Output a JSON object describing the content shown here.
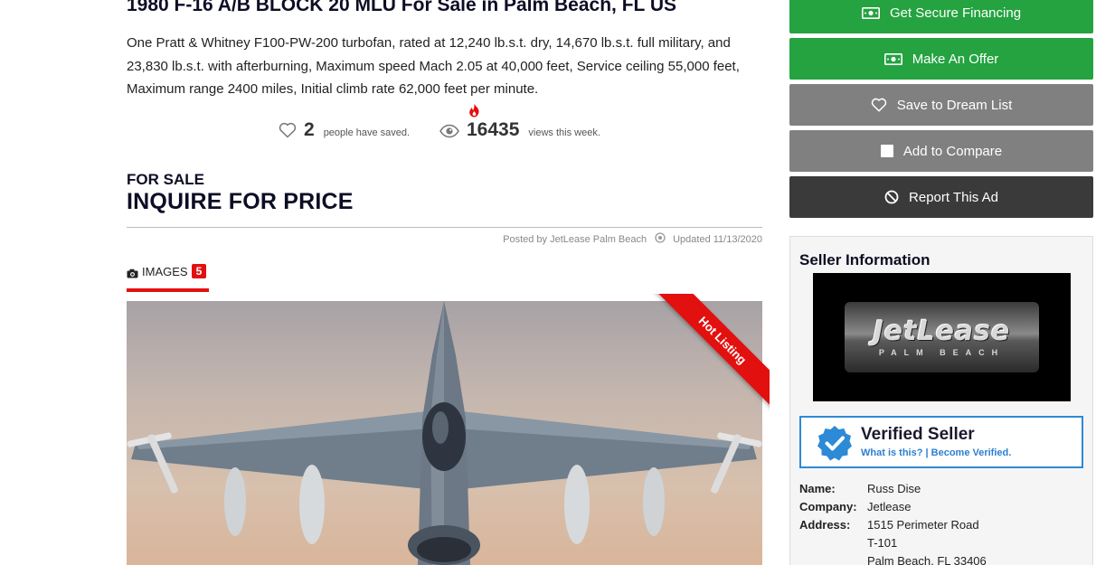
{
  "listing": {
    "title": "1980 F-16 A/B BLOCK 20 MLU For Sale in Palm Beach, FL US",
    "description": "One Pratt & Whitney F100-PW-200 turbofan, rated at 12,240 lb.s.t. dry, 14,670 lb.s.t. full military, and 23,830 lb.s.t. with afterburning, Maximum speed Mach 2.05 at 40,000 feet, Service ceiling 55,000 feet, Maximum range 2400 miles, Initial climb rate 62,000 feet per minute."
  },
  "stats": {
    "saved_count": "2",
    "saved_text": "people have saved.",
    "views_count": "16435",
    "views_text": "views this week."
  },
  "sale": {
    "status": "FOR SALE",
    "price": "INQUIRE FOR PRICE"
  },
  "meta": {
    "posted_by": "Posted by JetLease Palm Beach",
    "updated": "Updated 11/13/2020"
  },
  "images_tab": {
    "label": "IMAGES",
    "count": "5"
  },
  "ribbon": {
    "label": "Hot Listing"
  },
  "actions": {
    "financing": "Get Secure Financing",
    "offer": "Make An Offer",
    "save": "Save to Dream List",
    "compare": "Add to Compare",
    "report": "Report This Ad"
  },
  "seller": {
    "heading": "Seller Information",
    "logo_text": "JetLease",
    "logo_subtext": "PALM BEACH",
    "verified_title": "Verified Seller",
    "verified_links": "What is this? | Become Verified.",
    "name_label": "Name:",
    "name": "Russ Dise",
    "company_label": "Company:",
    "company": "Jetlease",
    "address_label": "Address:",
    "address_line1": "1515 Perimeter Road",
    "address_line2": "T-101",
    "address_line3": "Palm Beach, FL 33406"
  },
  "colors": {
    "green": "#24a340",
    "gray": "#808080",
    "dark": "#3a3a3a",
    "red": "#e31010",
    "verified_blue": "#2d8ad6"
  }
}
